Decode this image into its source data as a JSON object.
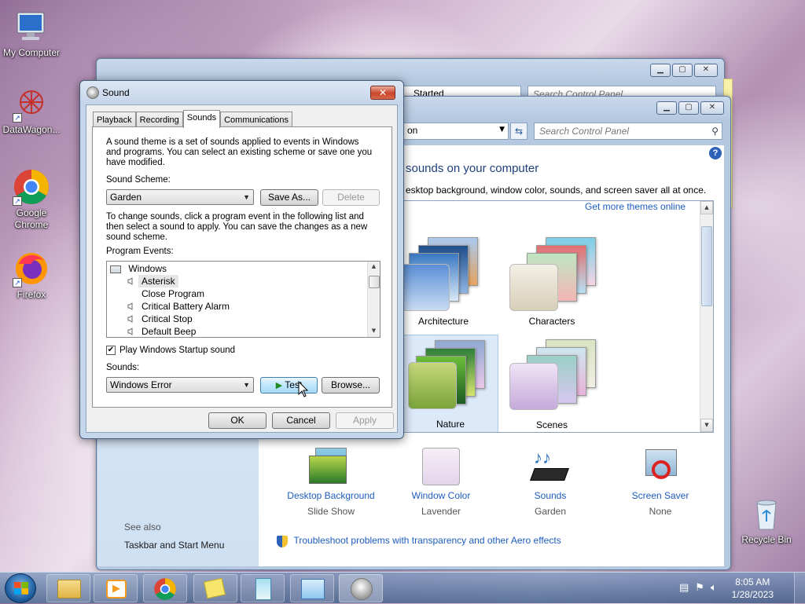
{
  "desktop": {
    "icons": [
      {
        "label": "My Computer"
      },
      {
        "label": "DataWagon..."
      },
      {
        "label": "Google Chrome"
      },
      {
        "label": "Firefox"
      },
      {
        "label": "Recycle Bin"
      }
    ]
  },
  "back_window": {
    "address_fragment": "Started",
    "search_placeholder": "Search Control Panel"
  },
  "control_panel": {
    "address_fragment": "on",
    "search_placeholder": "Search Control Panel",
    "heading": "sounds on your computer",
    "subheading": "esktop background, window color, sounds, and screen saver all at once.",
    "more_themes_link": "Get more themes online",
    "themes": [
      {
        "label": "Architecture"
      },
      {
        "label": "Characters"
      },
      {
        "label": "Nature"
      },
      {
        "label": "Scenes"
      }
    ],
    "bottom_items": [
      {
        "link": "Desktop Background",
        "sub": "Slide Show"
      },
      {
        "link": "Window Color",
        "sub": "Lavender"
      },
      {
        "link": "Sounds",
        "sub": "Garden"
      },
      {
        "link": "Screen Saver",
        "sub": "None"
      }
    ],
    "see_also": "See also",
    "taskbar_link": "Taskbar and Start Menu",
    "troubleshoot_link": "Troubleshoot problems with transparency and other Aero effects"
  },
  "sound_dialog": {
    "title": "Sound",
    "close_glyph": "✕",
    "tabs": [
      "Playback",
      "Recording",
      "Sounds",
      "Communications"
    ],
    "active_tab": "Sounds",
    "intro_lines": [
      "A sound theme is a set of sounds applied to events in Windows",
      "and programs.  You can select an existing scheme or save one you",
      "have modified."
    ],
    "scheme_label": "Sound Scheme:",
    "scheme_value": "Garden",
    "save_as": "Save As...",
    "delete": "Delete",
    "instructions_lines": [
      "To change sounds, click a program event in the following list and",
      "then select a sound to apply.  You can save the changes as a new",
      "sound scheme."
    ],
    "events_label": "Program Events:",
    "events": [
      {
        "label": "Windows",
        "type": "group"
      },
      {
        "label": "Asterisk",
        "type": "sound",
        "selected": true
      },
      {
        "label": "Close Program",
        "type": "none"
      },
      {
        "label": "Critical Battery Alarm",
        "type": "sound"
      },
      {
        "label": "Critical Stop",
        "type": "sound"
      },
      {
        "label": "Default Beep",
        "type": "sound"
      }
    ],
    "startup_checkbox": "Play Windows Startup sound",
    "startup_checked": true,
    "sounds_label": "Sounds:",
    "sound_value": "Windows Error",
    "test": "Test",
    "browse": "Browse...",
    "ok": "OK",
    "cancel": "Cancel",
    "apply": "Apply"
  },
  "taskbar": {
    "time": "8:05 AM",
    "date": "1/28/2023"
  }
}
